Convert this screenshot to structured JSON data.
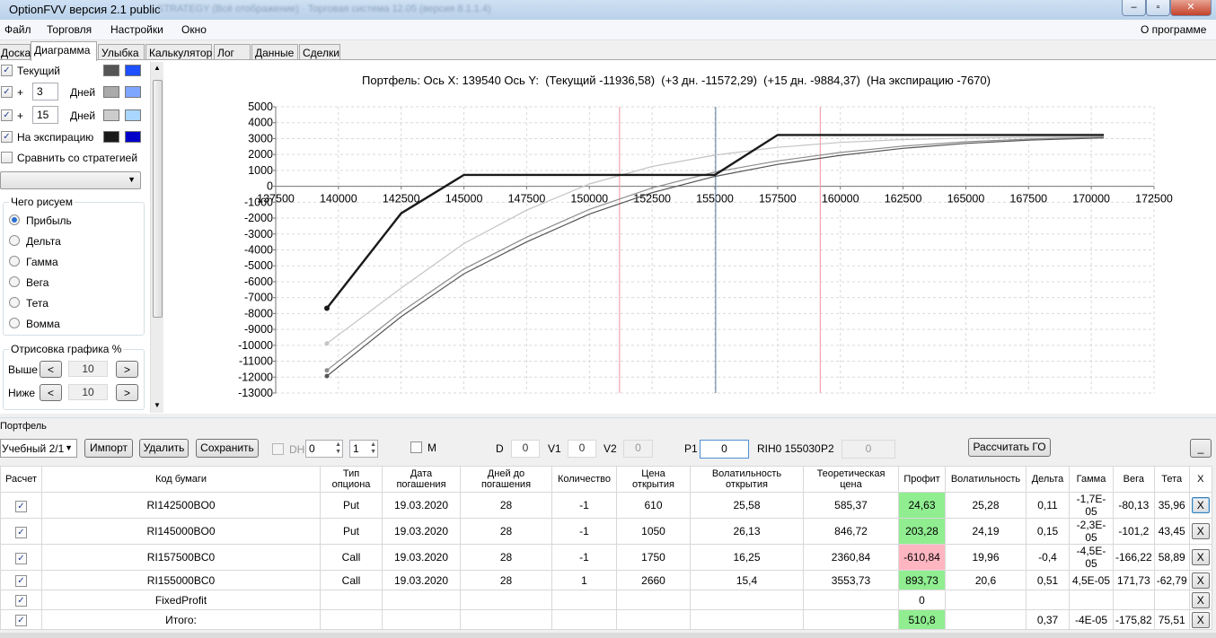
{
  "window": {
    "title": "OptionFVV версия 2.1 public",
    "blurred_title": "STRATEGY  (Всё отображение) · Торговая система 12.05 (версия 8.1.1.4)"
  },
  "menu": {
    "items": [
      "Файл",
      "Торговля",
      "Настройки",
      "Окно"
    ],
    "about": "О программе"
  },
  "tabs": [
    "Доска",
    "Диаграмма",
    "Улыбка",
    "Калькулятор",
    "Лог",
    "Данные",
    "Сделки"
  ],
  "active_tab": "Диаграмма",
  "left_panel": {
    "current_label": "Текущий",
    "plus_sign": "+",
    "days_label": "Дней",
    "days1": "3",
    "days2": "15",
    "expiry_label": "На экспирацию",
    "compare_label": "Сравнить со стратегией",
    "what_group": "Чего рисуем",
    "radios": [
      "Прибыль",
      "Дельта",
      "Гамма",
      "Вега",
      "Тета",
      "Вомма"
    ],
    "selected_radio": "Прибыль",
    "draw_group": "Отрисовка графика %",
    "above_label": "Выше",
    "below_label": "Ниже",
    "above_value": "10",
    "below_value": "10",
    "prev_glyph": "<",
    "next_glyph": ">",
    "swatch_colors": {
      "current": [
        "#555555",
        "#1e50ff"
      ],
      "plus3": [
        "#aaaaaa",
        "#7fa6ff"
      ],
      "plus15": [
        "#cccccc",
        "#a9d6ff"
      ],
      "expiry": [
        "#1a1a1a",
        "#0000c8"
      ]
    }
  },
  "chart_header": "Портфель: Ось X: 139540 Ось Y:  (Текущий -11936,58)  (+3 дн. -11572,29)  (+15 дн. -9884,37)  (На экспирацию -7670)",
  "chart_data": {
    "type": "line",
    "xlim": [
      137500,
      172500
    ],
    "ylim": [
      -13000,
      5000
    ],
    "x_ticks": [
      137500,
      140000,
      142500,
      145000,
      147500,
      150000,
      152500,
      155000,
      157500,
      160000,
      162500,
      165000,
      167500,
      170000,
      172500
    ],
    "y_ticks": [
      5000,
      4000,
      3000,
      2000,
      1000,
      0,
      -1000,
      -2000,
      -3000,
      -4000,
      -5000,
      -6000,
      -7000,
      -8000,
      -9000,
      -10000,
      -11000,
      -12000,
      -13000
    ],
    "grid": true,
    "vlines": [
      {
        "x": 151200,
        "color": "#f4a3b0"
      },
      {
        "x": 155030,
        "color": "#6d8ca8"
      },
      {
        "x": 159200,
        "color": "#f4a3b0"
      }
    ],
    "series": [
      {
        "color": "#1a1a1a",
        "width": 2.4,
        "points": [
          [
            139540,
            -7670
          ],
          [
            142500,
            -1700
          ],
          [
            145000,
            720
          ],
          [
            155000,
            720
          ],
          [
            157500,
            3230
          ],
          [
            170500,
            3230
          ]
        ]
      },
      {
        "color": "#c4c4c4",
        "width": 1.2,
        "points": [
          [
            139540,
            -9884
          ],
          [
            142500,
            -6400
          ],
          [
            145000,
            -3600
          ],
          [
            147500,
            -1500
          ],
          [
            150000,
            150
          ],
          [
            152500,
            1250
          ],
          [
            155000,
            1960
          ],
          [
            157500,
            2450
          ],
          [
            160000,
            2760
          ],
          [
            162500,
            2940
          ],
          [
            165000,
            3030
          ],
          [
            167500,
            3080
          ],
          [
            170500,
            3110
          ]
        ]
      },
      {
        "color": "#8c8c8c",
        "width": 1.2,
        "points": [
          [
            139540,
            -11572
          ],
          [
            142500,
            -7900
          ],
          [
            145000,
            -5200
          ],
          [
            147500,
            -3200
          ],
          [
            150000,
            -1450
          ],
          [
            152500,
            -100
          ],
          [
            155000,
            900
          ],
          [
            157500,
            1600
          ],
          [
            160000,
            2130
          ],
          [
            162500,
            2530
          ],
          [
            165000,
            2800
          ],
          [
            167500,
            2970
          ],
          [
            170500,
            3090
          ]
        ]
      },
      {
        "color": "#555555",
        "width": 1.2,
        "points": [
          [
            139540,
            -11936
          ],
          [
            142500,
            -8200
          ],
          [
            145000,
            -5500
          ],
          [
            147500,
            -3500
          ],
          [
            150000,
            -1750
          ],
          [
            152500,
            -400
          ],
          [
            155000,
            620
          ],
          [
            157500,
            1380
          ],
          [
            160000,
            1950
          ],
          [
            162500,
            2390
          ],
          [
            165000,
            2700
          ],
          [
            167500,
            2900
          ],
          [
            170500,
            3040
          ]
        ]
      }
    ]
  },
  "portfolio": {
    "group_label": "Портфель",
    "account": "Учебный 2/1",
    "import_btn": "Импорт",
    "delete_btn": "Удалить",
    "save_btn": "Сохранить",
    "dh_label": "DH",
    "dh_val1": "0",
    "dh_val2": "1",
    "m_label": "M",
    "d_label": "D",
    "d_value": "0",
    "v1_label": "V1",
    "v1_value": "0",
    "v2_label": "V2",
    "v2_value": "0",
    "p1_label": "P1",
    "p1_value": "0",
    "instrument": "RIH0 155030",
    "p2_label": "P2",
    "p2_value": "0",
    "calc_btn": "Рассчитать ГО",
    "min_btn": "_"
  },
  "table": {
    "headers": [
      "Расчет",
      "Код бумаги",
      "Тип\nопциона",
      "Дата\nпогашения",
      "Дней до\nпогашения",
      "Количество",
      "Цена\nоткрытия",
      "Волатильность\nоткрытия",
      "Теоретическая\nцена",
      "Профит",
      "Волатильность",
      "Дельта",
      "Гамма",
      "Вега",
      "Тета",
      "X"
    ],
    "rows": [
      [
        "RI142500BO0",
        "Put",
        "19.03.2020",
        "28",
        "-1",
        "610",
        "25,58",
        "585,37",
        "24,63",
        "25,28",
        "0,11",
        "-1,7E-05",
        "-80,13",
        "35,96"
      ],
      [
        "RI145000BO0",
        "Put",
        "19.03.2020",
        "28",
        "-1",
        "1050",
        "26,13",
        "846,72",
        "203,28",
        "24,19",
        "0,15",
        "-2,3E-05",
        "-101,2",
        "43,45"
      ],
      [
        "RI157500BC0",
        "Call",
        "19.03.2020",
        "28",
        "-1",
        "1750",
        "16,25",
        "2360,84",
        "-610,84",
        "19,96",
        "-0,4",
        "-4,5E-05",
        "-166,22",
        "58,89"
      ],
      [
        "RI155000BC0",
        "Call",
        "19.03.2020",
        "28",
        "1",
        "2660",
        "15,4",
        "3553,73",
        "893,73",
        "20,6",
        "0,51",
        "4,5E-05",
        "171,73",
        "-62,79"
      ],
      [
        "FixedProfit",
        "",
        "",
        "",
        "",
        "",
        "",
        "",
        "0",
        "",
        "",
        "",
        "",
        ""
      ],
      [
        "Итого:",
        "",
        "",
        "",
        "",
        "",
        "",
        "",
        "510,8",
        "",
        "0,37",
        "-4E-05",
        "-175,82",
        "75,51"
      ]
    ],
    "check_glyph": "✓",
    "x_glyph": "X"
  }
}
